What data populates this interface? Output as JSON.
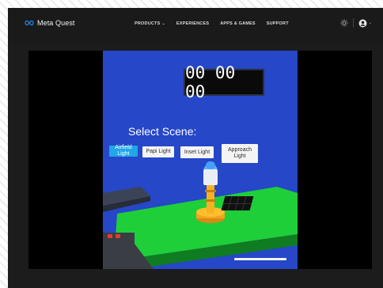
{
  "header": {
    "logo_text": "Meta Quest",
    "nav": [
      {
        "label": "PRODUCTS",
        "has_dropdown": true
      },
      {
        "label": "EXPERIENCES",
        "has_dropdown": false
      },
      {
        "label": "APPS & GAMES",
        "has_dropdown": false
      },
      {
        "label": "SUPPORT",
        "has_dropdown": false
      }
    ],
    "icons": {
      "theme": "sun-icon",
      "account": "account-icon",
      "account_dropdown": "chevron-down-icon"
    }
  },
  "video": {
    "clock": "00 00 00",
    "title": "Select Scene:",
    "buttons": [
      {
        "label": "Airfield Light",
        "active": true
      },
      {
        "label": "Papi Light",
        "active": false
      },
      {
        "label": "Inset Light",
        "active": false
      },
      {
        "label": "Approach Light",
        "active": false
      }
    ]
  },
  "colors": {
    "sky": "#2547c8",
    "floor": "#1fcf3a",
    "accent": "#21a6e8",
    "page_bg": "#1c1c1c"
  }
}
